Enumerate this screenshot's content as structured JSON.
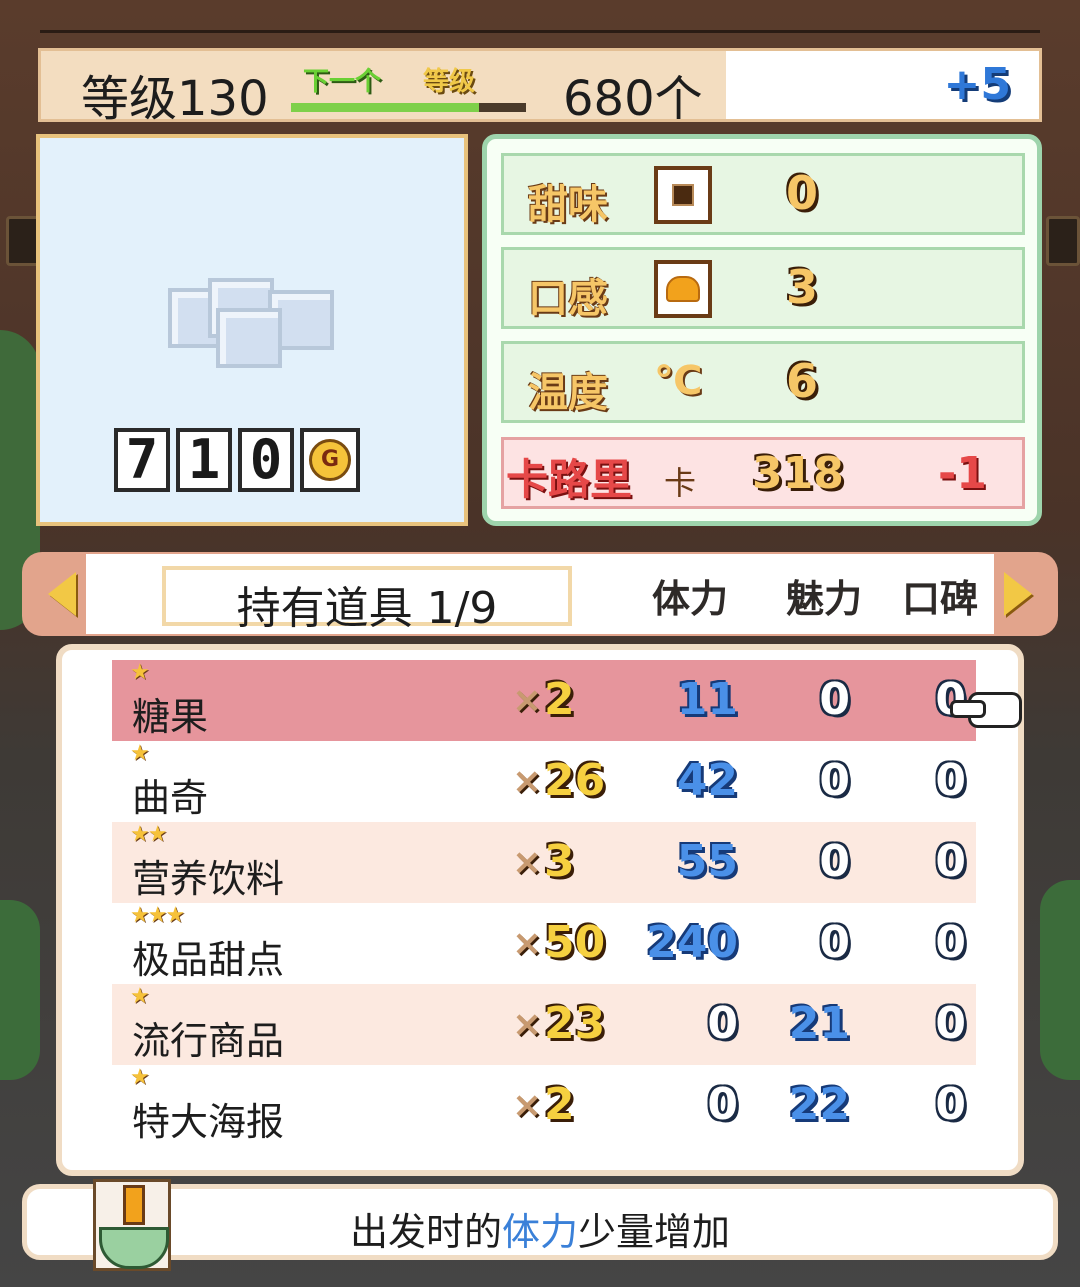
{
  "header": {
    "level_text": "等级130",
    "next_label": "下一个",
    "level_label": "等级",
    "exp_progress": 0.8,
    "count_text": "680个",
    "bonus": "+5"
  },
  "item_preview": {
    "price_digits": [
      "7",
      "1",
      "0"
    ],
    "currency_symbol": "G"
  },
  "stats": [
    {
      "name": "甜味",
      "icon": "sweet-icon",
      "value": "0"
    },
    {
      "name": "口感",
      "icon": "texture-icon",
      "value": "3"
    },
    {
      "name": "温度",
      "icon": "celsius-icon",
      "value": "6"
    }
  ],
  "temp_unit": "℃",
  "calories": {
    "name": "卡路里",
    "unit": "卡",
    "value": "318",
    "delta": "-1"
  },
  "inventory": {
    "title": "持有道具 1/9",
    "columns": [
      "体力",
      "魅力",
      "口碑"
    ],
    "items": [
      {
        "stars": "★",
        "name": "糖果",
        "qty_prefix": "×",
        "qty": "2",
        "stamina": "11",
        "charm": "0",
        "reputation": "0",
        "selected": true
      },
      {
        "stars": "★",
        "name": "曲奇",
        "qty_prefix": "×",
        "qty": "26",
        "stamina": "42",
        "charm": "0",
        "reputation": "0"
      },
      {
        "stars": "★★",
        "name": "营养饮料",
        "qty_prefix": "×",
        "qty": "3",
        "stamina": "55",
        "charm": "0",
        "reputation": "0"
      },
      {
        "stars": "★★★",
        "name": "极品甜点",
        "qty_prefix": "×",
        "qty": "50",
        "stamina": "240",
        "charm": "0",
        "reputation": "0"
      },
      {
        "stars": "★",
        "name": "流行商品",
        "qty_prefix": "×",
        "qty": "23",
        "stamina": "0",
        "charm": "21",
        "reputation": "0"
      },
      {
        "stars": "★",
        "name": "特大海报",
        "qty_prefix": "×",
        "qty": "2",
        "stamina": "0",
        "charm": "22",
        "reputation": "0"
      }
    ]
  },
  "description": {
    "before": "出发时的",
    "highlight": "体力",
    "after": "少量增加"
  },
  "colors": {
    "accent_blue": "#4a90e8",
    "highlight_row": "#e6959c",
    "calorie_red": "#e64848",
    "gold_text": "#f6c667"
  }
}
